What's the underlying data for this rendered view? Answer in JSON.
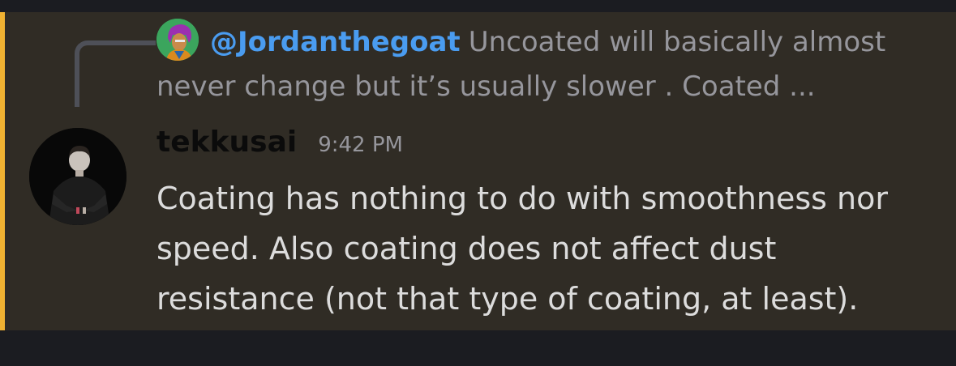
{
  "reply": {
    "mention": "@Jordanthegoat",
    "preview": "Uncoated will basically almost never change but it’s usually slower . Coated ..."
  },
  "message": {
    "username": "tekkusai",
    "timestamp": "9:42 PM",
    "content": "Coating has nothing to do with smoothness nor speed. Also coating does not affect dust resistance (not that type of coating, at least)."
  },
  "icons": {
    "reply_avatar": "reply-user-avatar",
    "author_avatar": "author-avatar"
  },
  "colors": {
    "page_background": "#1b1c21",
    "message_background": "#302c25",
    "highlight_bar": "#f0b232",
    "mention": "#4a9cf0",
    "muted_text": "#96969c",
    "message_text": "#dcdcdc",
    "username": "#0b0b0b"
  }
}
